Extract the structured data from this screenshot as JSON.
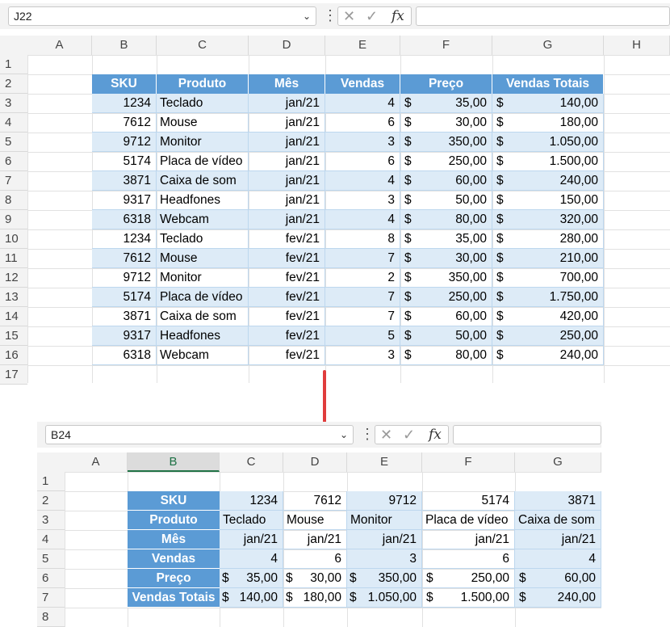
{
  "top": {
    "namebox": "J22",
    "columns": [
      "A",
      "B",
      "C",
      "D",
      "E",
      "F",
      "G",
      "H"
    ],
    "rows": [
      "1",
      "2",
      "3",
      "4",
      "5",
      "6",
      "7",
      "8",
      "9",
      "10",
      "11",
      "12",
      "13",
      "14",
      "15",
      "16",
      "17"
    ],
    "headers": [
      "SKU",
      "Produto",
      "Mês",
      "Vendas",
      "Preço",
      "Vendas Totais"
    ],
    "data": [
      [
        "1234",
        "Teclado",
        "jan/21",
        "4",
        "35,00",
        "140,00"
      ],
      [
        "7612",
        "Mouse",
        "jan/21",
        "6",
        "30,00",
        "180,00"
      ],
      [
        "9712",
        "Monitor",
        "jan/21",
        "3",
        "350,00",
        "1.050,00"
      ],
      [
        "5174",
        "Placa de vídeo",
        "jan/21",
        "6",
        "250,00",
        "1.500,00"
      ],
      [
        "3871",
        "Caixa de som",
        "jan/21",
        "4",
        "60,00",
        "240,00"
      ],
      [
        "9317",
        "Headfones",
        "jan/21",
        "3",
        "50,00",
        "150,00"
      ],
      [
        "6318",
        "Webcam",
        "jan/21",
        "4",
        "80,00",
        "320,00"
      ],
      [
        "1234",
        "Teclado",
        "fev/21",
        "8",
        "35,00",
        "280,00"
      ],
      [
        "7612",
        "Mouse",
        "fev/21",
        "7",
        "30,00",
        "210,00"
      ],
      [
        "9712",
        "Monitor",
        "fev/21",
        "2",
        "350,00",
        "700,00"
      ],
      [
        "5174",
        "Placa de vídeo",
        "fev/21",
        "7",
        "250,00",
        "1.750,00"
      ],
      [
        "3871",
        "Caixa de som",
        "fev/21",
        "7",
        "60,00",
        "420,00"
      ],
      [
        "9317",
        "Headfones",
        "fev/21",
        "5",
        "50,00",
        "250,00"
      ],
      [
        "6318",
        "Webcam",
        "fev/21",
        "3",
        "80,00",
        "240,00"
      ]
    ]
  },
  "bottom": {
    "namebox": "B24",
    "columns": [
      "A",
      "B",
      "C",
      "D",
      "E",
      "F",
      "G"
    ],
    "rows": [
      "1",
      "2",
      "3",
      "4",
      "5",
      "6",
      "7",
      "8"
    ],
    "headers": [
      "SKU",
      "Produto",
      "Mês",
      "Vendas",
      "Preço",
      "Vendas Totais"
    ],
    "data": [
      [
        "1234",
        "7612",
        "9712",
        "5174",
        "3871"
      ],
      [
        "Teclado",
        "Mouse",
        "Monitor",
        "Placa de vídeo",
        "Caixa de som"
      ],
      [
        "jan/21",
        "jan/21",
        "jan/21",
        "jan/21",
        "jan/21"
      ],
      [
        "4",
        "6",
        "3",
        "6",
        "4"
      ],
      [
        "35,00",
        "30,00",
        "350,00",
        "250,00",
        "60,00"
      ],
      [
        "140,00",
        "180,00",
        "1.050,00",
        "1.500,00",
        "240,00"
      ]
    ]
  },
  "currency": "$",
  "icons": {
    "cancel": "✕",
    "enter": "✓",
    "fx": "fx",
    "chevron": "⌄",
    "dots": "⋮"
  },
  "colors": {
    "header_fill": "#5b9bd5",
    "band_fill": "#ddebf7",
    "arrow": "#e03c3c"
  }
}
